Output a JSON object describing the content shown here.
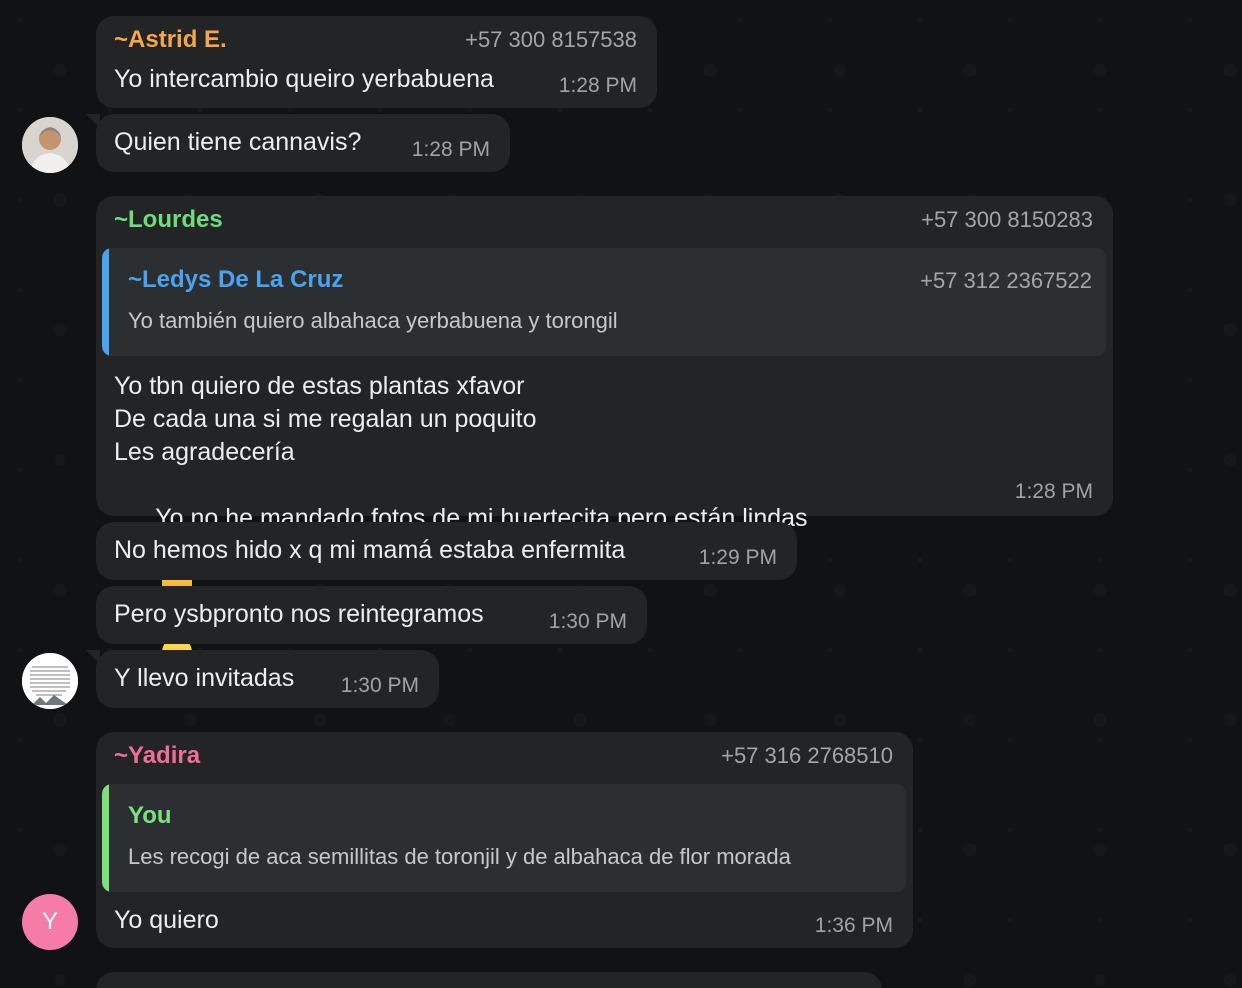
{
  "colors": {
    "astrid": "#f6a54a",
    "lourdes": "#6fdc7c",
    "ledys": "#4aa3f0",
    "yadira": "#f16e97",
    "you": "#7ee07c",
    "avatar_y": "#f67ca8"
  },
  "messages": [
    {
      "sender": "~Astrid E.",
      "phone": "+57 300 8157538",
      "text": "Yo intercambio queiro yerbabuena",
      "time": "1:28 PM"
    },
    {
      "text": "Quien tiene cannavis?",
      "time": "1:28 PM",
      "avatar": "photo-avatar"
    },
    {
      "sender": "~Lourdes",
      "phone": "+57 300 8150283",
      "quote": {
        "name": "~Ledys De La Cruz",
        "phone": "+57 312 2367522",
        "text": "Yo también quiero albahaca yerbabuena y torongil"
      },
      "lines": [
        "Yo tbn quiero de estas plantas xfavor",
        "De cada una si me regalan un poquito",
        "Les agradecería",
        "Yo no he mandado fotos de mi huertecita pero están lindas"
      ],
      "emojis": [
        "smiling-face-icon",
        "thumbs-up-icon",
        "hearts-face-icon",
        "hand-over-mouth-icon"
      ],
      "time": "1:28 PM"
    },
    {
      "text": "No hemos hido x q mi mamá estaba enfermita",
      "time": "1:29 PM"
    },
    {
      "text": "Pero ysbpronto nos reintegramos",
      "time": "1:30 PM"
    },
    {
      "text": "Y llevo invitadas",
      "time": "1:30 PM",
      "avatar": "text-image-avatar"
    },
    {
      "sender": "~Yadira",
      "phone": "+57 316 2768510",
      "quote": {
        "name": "You",
        "text": "Les recogi de aca semillitas de toronjil y de albahaca de flor morada"
      },
      "text": "Yo quiero",
      "time": "1:36 PM",
      "avatar_letter": "Y"
    }
  ]
}
